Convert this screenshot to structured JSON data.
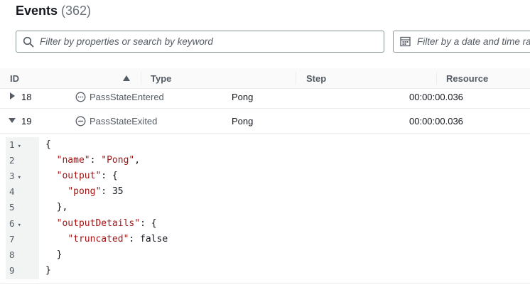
{
  "header": {
    "title": "Events",
    "count": "(362)"
  },
  "filters": {
    "search_placeholder": "Filter by properties or search by keyword",
    "date_placeholder": "Filter by a date and time range"
  },
  "table": {
    "columns": [
      "ID",
      "Type",
      "Step",
      "Resource"
    ],
    "rows": [
      {
        "id": "18",
        "type": "PassStateEntered",
        "step": "Pong",
        "resource": "00:00:00.036",
        "expanded": false
      },
      {
        "id": "19",
        "type": "PassStateExited",
        "step": "Pong",
        "resource": "00:00:00.036",
        "expanded": true
      }
    ]
  },
  "details": {
    "line_numbers": [
      "1",
      "2",
      "3",
      "4",
      "5",
      "6",
      "7",
      "8",
      "9"
    ],
    "foldable": [
      true,
      false,
      true,
      false,
      false,
      true,
      false,
      false,
      false
    ],
    "lines": [
      "{",
      "  \"name\": \"Pong\",",
      "  \"output\": {",
      "    \"pong\": 35",
      "  },",
      "  \"outputDetails\": {",
      "    \"truncated\": false",
      "  }",
      "}"
    ]
  },
  "colors": {
    "accent": "#545b64",
    "json_key": "#a31515"
  }
}
